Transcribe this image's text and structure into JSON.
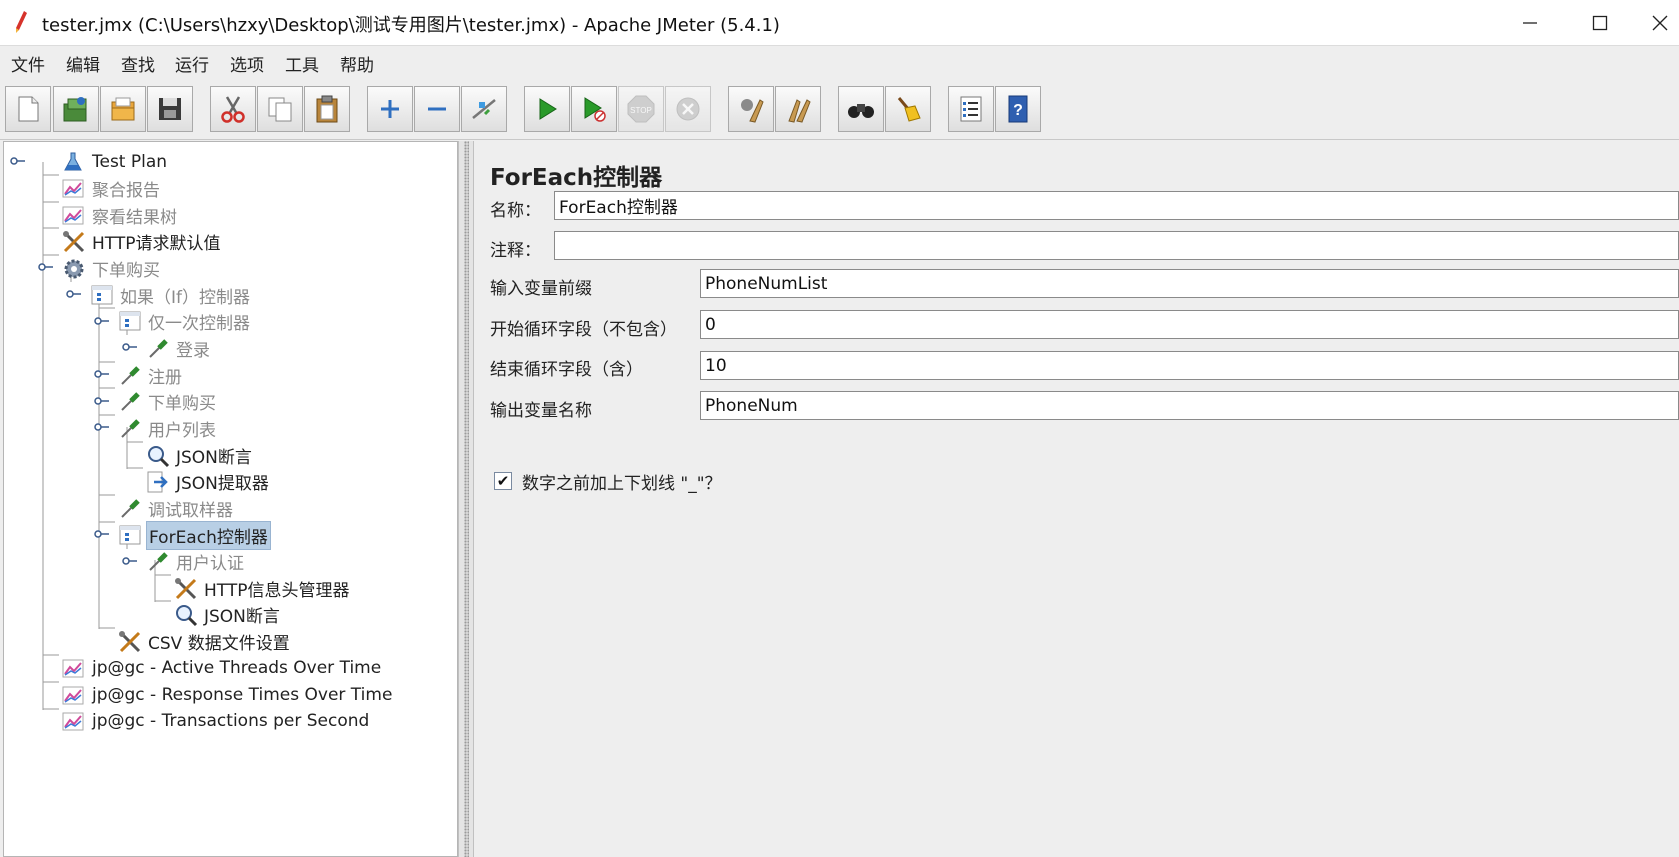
{
  "window": {
    "title": "tester.jmx (C:\\Users\\hzxy\\Desktop\\测试专用图片\\tester.jmx) - Apache JMeter (5.4.1)"
  },
  "menu": [
    "文件",
    "编辑",
    "查找",
    "运行",
    "选项",
    "工具",
    "帮助"
  ],
  "toolbar": {
    "buttons": [
      "new",
      "templates",
      "open",
      "save",
      "cut",
      "copy",
      "paste",
      "expand",
      "collapse",
      "toggle",
      "start",
      "start-no-pauses",
      "stop",
      "shutdown",
      "clear",
      "clear-all",
      "search",
      "reset-search",
      "function-helper",
      "help"
    ]
  },
  "tree": [
    {
      "label": "Test Plan",
      "icon": "test-plan-icon"
    },
    {
      "label": "聚合报告",
      "icon": "graph-icon"
    },
    {
      "label": "察看结果树",
      "icon": "graph-icon"
    },
    {
      "label": "HTTP请求默认值",
      "icon": "tools-icon"
    },
    {
      "label": "下单购买",
      "icon": "gear-icon"
    },
    {
      "label": "如果（If）控制器",
      "icon": "controller-icon"
    },
    {
      "label": "仅一次控制器",
      "icon": "controller-icon"
    },
    {
      "label": "登录",
      "icon": "pipette-icon"
    },
    {
      "label": "注册",
      "icon": "pipette-icon"
    },
    {
      "label": "下单购买",
      "icon": "pipette-icon"
    },
    {
      "label": "用户列表",
      "icon": "pipette-icon"
    },
    {
      "label": "JSON断言",
      "icon": "magnifier-icon"
    },
    {
      "label": "JSON提取器",
      "icon": "extractor-icon"
    },
    {
      "label": "调试取样器",
      "icon": "pipette-icon"
    },
    {
      "label": "ForEach控制器",
      "icon": "controller-icon"
    },
    {
      "label": "用户认证",
      "icon": "pipette-icon"
    },
    {
      "label": "HTTP信息头管理器",
      "icon": "tools-icon"
    },
    {
      "label": "JSON断言",
      "icon": "magnifier-icon"
    },
    {
      "label": "CSV 数据文件设置",
      "icon": "tools-icon"
    },
    {
      "label": "jp@gc - Active Threads Over Time",
      "icon": "graph-icon"
    },
    {
      "label": "jp@gc - Response Times Over Time",
      "icon": "graph-icon"
    },
    {
      "label": "jp@gc - Transactions per Second",
      "icon": "graph-icon"
    }
  ],
  "editor": {
    "title": "ForEach控制器",
    "name_label": "名称：",
    "name_value": "ForEach控制器",
    "comment_label": "注释：",
    "comment_value": "",
    "input_prefix_label": "输入变量前缀",
    "input_prefix_value": "PhoneNumList",
    "start_label": "开始循环字段（不包含）",
    "start_value": "0",
    "end_label": "结束循环字段（含）",
    "end_value": "10",
    "output_label": "输出变量名称",
    "output_value": "PhoneNum",
    "underscore_label": "数字之前加上下划线 \"_\"？",
    "underscore_checked": true,
    "check_mark": "✔"
  }
}
